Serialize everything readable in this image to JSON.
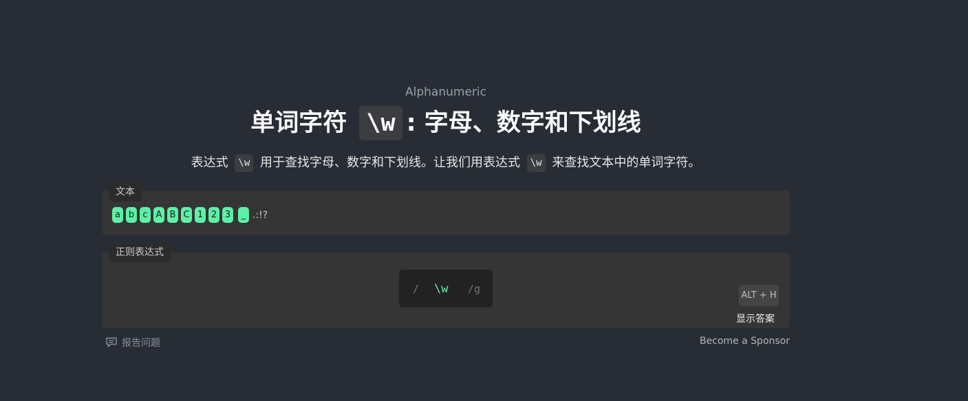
{
  "header": {
    "subtitle": "Alphanumeric",
    "title_before": "单词字符",
    "title_code": "\\w",
    "title_after": ": 字母、数字和下划线"
  },
  "description": {
    "part1": "表达式",
    "code1": "\\w",
    "part2": "用于查找字母、数字和下划线。让我们用表达式",
    "code2": "\\w",
    "part3": "来查找文本中的单词字符。"
  },
  "text_panel": {
    "label": "文本",
    "matched_chars": [
      "a",
      "b",
      "c",
      "A",
      "B",
      "C",
      "1",
      "2",
      "3",
      "_"
    ],
    "unmatched_text": ".:!?"
  },
  "regex_panel": {
    "label": "正则表达式",
    "open_slash": "/",
    "pattern": "\\w",
    "flags": "/g",
    "hint_shortcut": "ALT + H",
    "hint_label": "显示答案"
  },
  "footer": {
    "report_label": "报告问题",
    "sponsor_label": "Become a Sponsor"
  },
  "colors": {
    "background": "#282c34",
    "panel": "#353535",
    "match_highlight": "#5df0a6"
  }
}
